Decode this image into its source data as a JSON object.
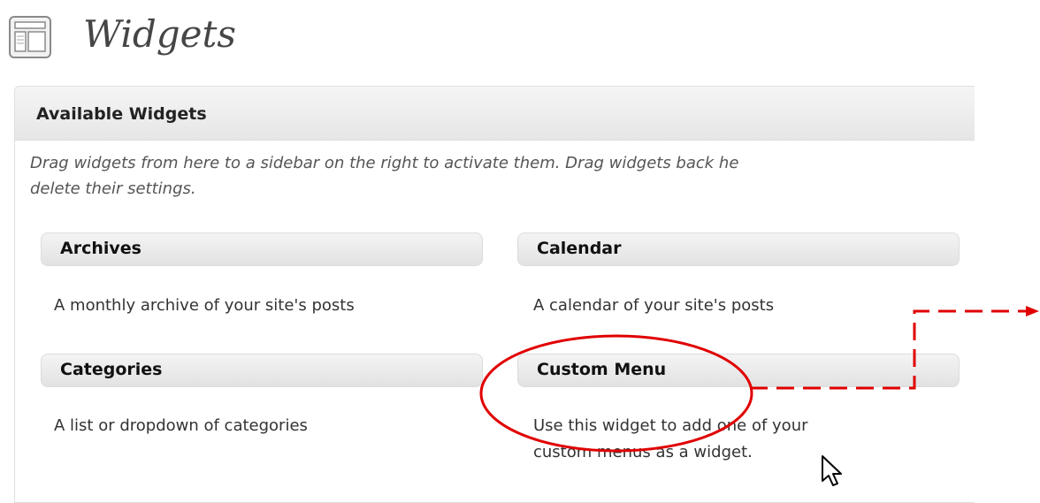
{
  "page": {
    "title": "Widgets",
    "icon": "widgets-screen-icon"
  },
  "available_widgets": {
    "heading": "Available Widgets",
    "description_line1": "Drag widgets from here to a sidebar on the right to activate them. Drag widgets back he",
    "description_line2": "delete their settings.",
    "widgets": [
      {
        "name": "Archives",
        "description_lines": [
          "A monthly archive of your site's posts"
        ]
      },
      {
        "name": "Calendar",
        "description_lines": [
          "A calendar of your site's posts"
        ]
      },
      {
        "name": "Categories",
        "description_lines": [
          "A list or dropdown of categories"
        ]
      },
      {
        "name": "Custom Menu",
        "description_lines": [
          "Use this widget to add one of your",
          "custom menus as a widget."
        ]
      }
    ]
  },
  "annotation": {
    "highlight_color": "#e00000",
    "highlighted_widget": "Custom Menu"
  },
  "colors": {
    "header_text": "#464646",
    "widget_bar": "#e2e2e2",
    "border": "#dfdfdf"
  }
}
